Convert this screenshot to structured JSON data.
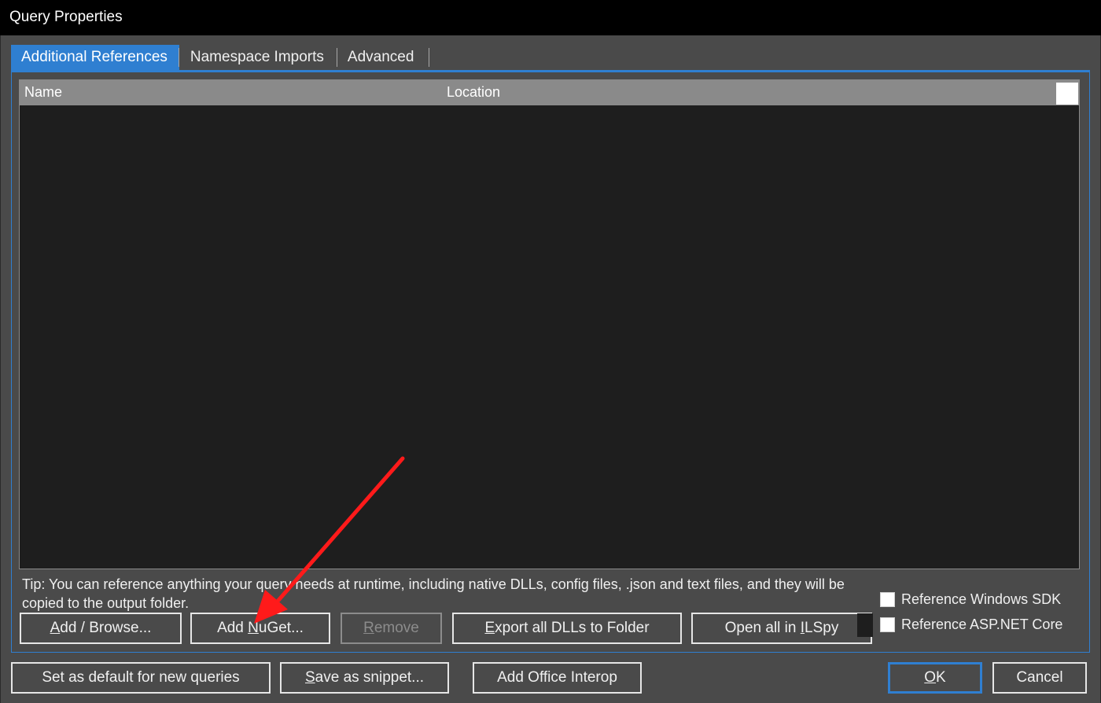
{
  "window": {
    "title": "Query Properties"
  },
  "tabs": [
    {
      "label": "Additional References"
    },
    {
      "label": "Namespace Imports"
    },
    {
      "label": "Advanced"
    }
  ],
  "list": {
    "columns": [
      "Name",
      "Location"
    ],
    "rows": []
  },
  "tip": "Tip: You can reference anything your query needs at runtime, including native DLLs, config files, .json and text files, and they will be copied to the output folder.",
  "panel_buttons": {
    "add_browse": {
      "pre": "",
      "mnemonic": "A",
      "post": "dd / Browse..."
    },
    "add_nuget": {
      "pre": "Add ",
      "mnemonic": "N",
      "post": "uGet..."
    },
    "remove": {
      "pre": "",
      "mnemonic": "R",
      "post": "emove"
    },
    "export_dlls": {
      "pre": "",
      "mnemonic": "E",
      "post": "xport all DLLs to Folder"
    },
    "open_ilspy": {
      "pre": "Open all in ",
      "mnemonic": "I",
      "post": "LSpy"
    }
  },
  "checkboxes": {
    "windows_sdk": {
      "label": "Reference Windows SDK",
      "checked": false
    },
    "aspnet_core": {
      "label": "Reference ASP.NET Core",
      "checked": false
    }
  },
  "footer_buttons": {
    "set_default": {
      "label": "Set as default for new queries"
    },
    "save_snippet": {
      "pre": "",
      "mnemonic": "S",
      "post": "ave as snippet..."
    },
    "office_interop": {
      "label": "Add Office Interop"
    },
    "ok": {
      "pre": "",
      "mnemonic": "O",
      "post": "K"
    },
    "cancel": {
      "label": "Cancel"
    }
  },
  "colors": {
    "accent": "#2f7fd1",
    "annotation_arrow": "#ff1a1a",
    "background": "#4a4a4a",
    "list_bg": "#1e1e1e"
  },
  "icons": {
    "annotation": "red-arrow-icon"
  }
}
